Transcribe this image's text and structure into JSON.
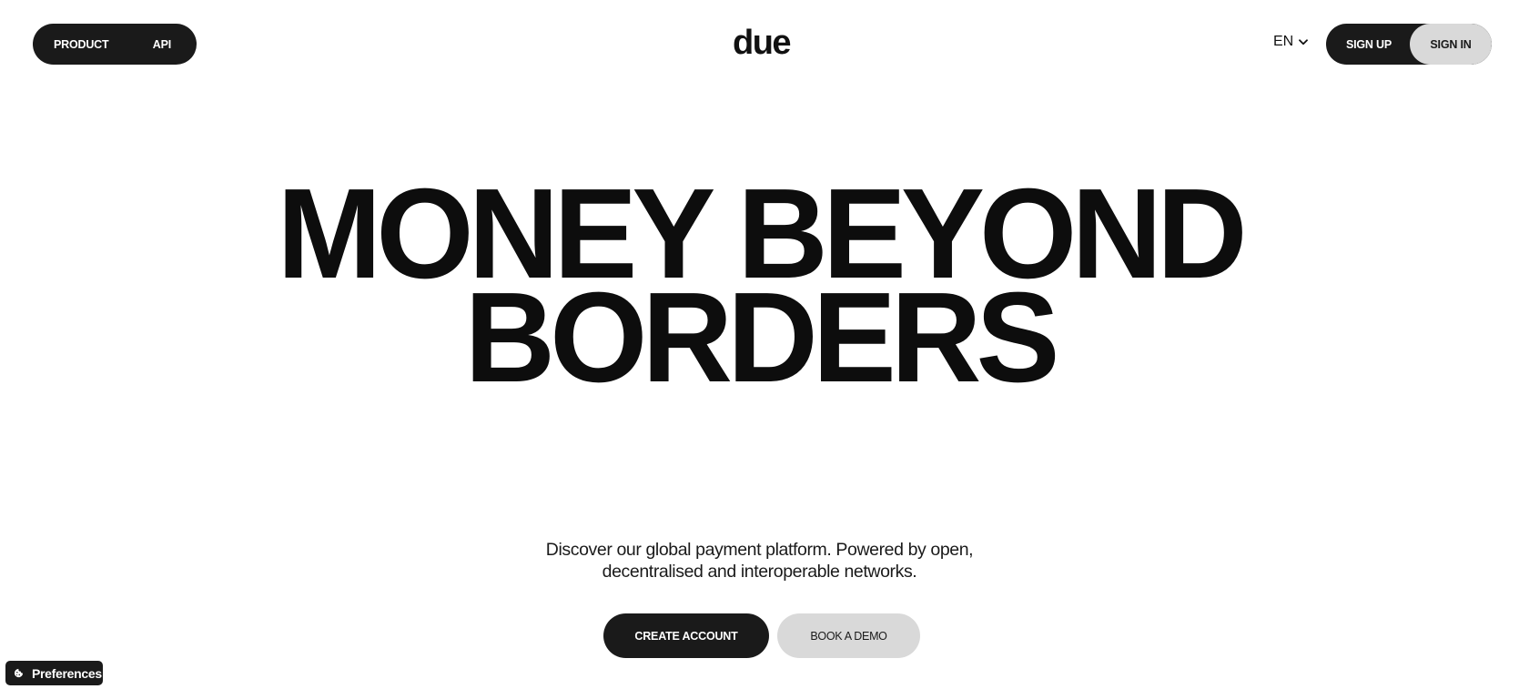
{
  "header": {
    "nav": [
      {
        "label": "PRODUCT"
      },
      {
        "label": "API"
      }
    ],
    "logo": "due",
    "language": "EN",
    "sign_up_label": "SIGN UP",
    "sign_in_label": "SIGN IN"
  },
  "hero": {
    "title_line_1": "MONEY BEYOND",
    "title_line_2": "BORDERS",
    "subtitle_line_1": "Discover our global payment platform. Powered by open,",
    "subtitle_line_2": "decentralised and interoperable networks."
  },
  "cta": {
    "create_account_label": "CREATE ACCOUNT",
    "book_demo_label": "BOOK A DEMO"
  },
  "preferences": {
    "label": "Preferences",
    "icon": "cookie-icon"
  },
  "colors": {
    "dark": "#1a1a1a",
    "light_button": "#d9d9d9",
    "background": "#ffffff"
  }
}
